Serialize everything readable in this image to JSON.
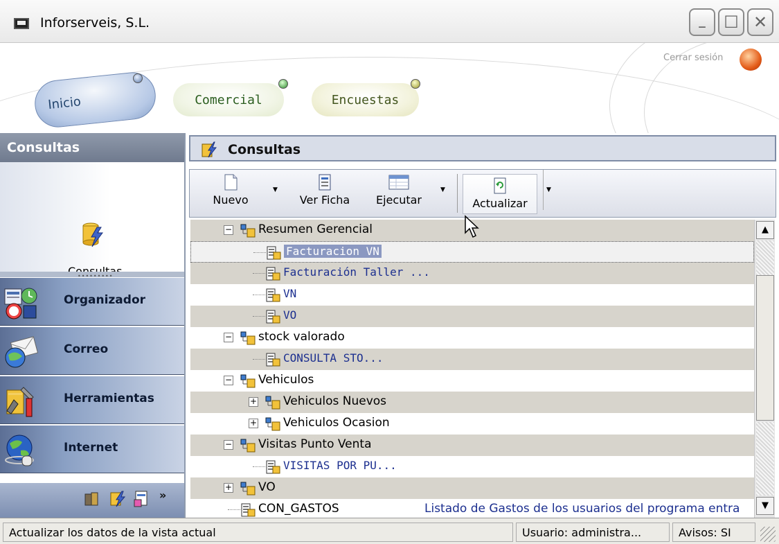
{
  "window": {
    "title": "Inforserveis, S.L.",
    "buttons": {
      "minimize": "–",
      "maximize": "☐",
      "close": "✕"
    }
  },
  "header": {
    "modules": [
      {
        "label": "Inicio",
        "led": "blue"
      },
      {
        "label": "Comercial",
        "led": "green"
      },
      {
        "label": "Encuestas",
        "led": "olive"
      }
    ],
    "logout_label": "Cerrar sesión"
  },
  "sidebar": {
    "title": "Consultas",
    "active_item_label": "Consultas",
    "nav": [
      {
        "label": "Organizador",
        "icon": "organizer-icon"
      },
      {
        "label": "Correo",
        "icon": "mail-icon"
      },
      {
        "label": "Herramientas",
        "icon": "tools-icon"
      },
      {
        "label": "Internet",
        "icon": "internet-icon"
      }
    ],
    "more_glyph": "»"
  },
  "main": {
    "title": "Consultas",
    "toolbar": {
      "nuevo": "Nuevo",
      "ver_ficha": "Ver Ficha",
      "ejecutar": "Ejecutar",
      "actualizar": "Actualizar"
    },
    "tree": [
      {
        "label": "Resumen Gerencial",
        "type": "folder",
        "level": 0,
        "expanded": true
      },
      {
        "label": "Facturacion VN",
        "type": "query",
        "level": 1,
        "selected": true
      },
      {
        "label": "Facturación Taller ...",
        "type": "query",
        "level": 1
      },
      {
        "label": "VN",
        "type": "query",
        "level": 1
      },
      {
        "label": "VO",
        "type": "query",
        "level": 1
      },
      {
        "label": "stock valorado",
        "type": "folder",
        "level": 0,
        "expanded": true
      },
      {
        "label": "CONSULTA STO...",
        "type": "query",
        "level": 1
      },
      {
        "label": "Vehiculos",
        "type": "folder",
        "level": 0,
        "expanded": true
      },
      {
        "label": "Vehiculos Nuevos",
        "type": "folder",
        "level": 1,
        "expanded": false
      },
      {
        "label": "Vehiculos Ocasion",
        "type": "folder",
        "level": 1,
        "expanded": false
      },
      {
        "label": "Visitas Punto Venta",
        "type": "folder",
        "level": 0,
        "expanded": true
      },
      {
        "label": "VISITAS POR PU...",
        "type": "query",
        "level": 1
      },
      {
        "label": "VO",
        "type": "folder",
        "level": 0,
        "expanded": false
      },
      {
        "label": "CON_GASTOS",
        "type": "query",
        "level": 0,
        "description": "Listado de Gastos de los usuarios del programa entra"
      }
    ]
  },
  "status": {
    "message": "Actualizar los datos de la vista actual",
    "user": "Usuario: administra...",
    "avisos": "Avisos: SI"
  }
}
